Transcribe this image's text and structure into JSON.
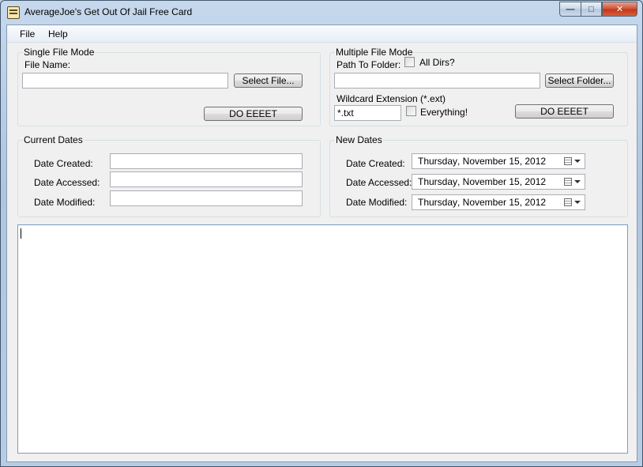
{
  "window": {
    "title": "AverageJoe's Get Out Of Jail Free Card"
  },
  "icons": {
    "app": "app-card-icon",
    "minimize": "minimize-icon",
    "maximize": "maximize-icon",
    "close": "close-icon",
    "calendar": "calendar-icon",
    "dropdown": "chevron-down-icon"
  },
  "menu": {
    "file": "File",
    "help": "Help"
  },
  "single": {
    "group_label": "Single File Mode",
    "file_name_label": "File Name:",
    "file_name_value": "",
    "select_button": "Select File...",
    "go_button": "DO EEEET"
  },
  "multiple": {
    "group_label": "Multiple File Mode",
    "path_label": "Path To Folder:",
    "all_dirs_label": "All Dirs?",
    "all_dirs_checked": false,
    "path_value": "",
    "select_button": "Select Folder...",
    "wildcard_label": "Wildcard Extension (*.ext)",
    "wildcard_value": "*.txt",
    "everything_label": "Everything!",
    "everything_checked": false,
    "go_button": "DO EEEET"
  },
  "current_dates": {
    "group_label": "Current Dates",
    "created_label": "Date Created:",
    "accessed_label": "Date Accessed:",
    "modified_label": "Date Modified:",
    "created_value": "",
    "accessed_value": "",
    "modified_value": ""
  },
  "new_dates": {
    "group_label": "New Dates",
    "created_label": "Date Created:",
    "accessed_label": "Date Accessed:",
    "modified_label": "Date Modified:",
    "created_day": "Thursday",
    "created_date": ", November 15, 2012",
    "accessed_day": "Thursday",
    "accessed_date": ", November 15, 2012",
    "modified_day": "Thursday",
    "modified_date": ", November 15, 2012"
  },
  "log": {
    "content": ""
  }
}
